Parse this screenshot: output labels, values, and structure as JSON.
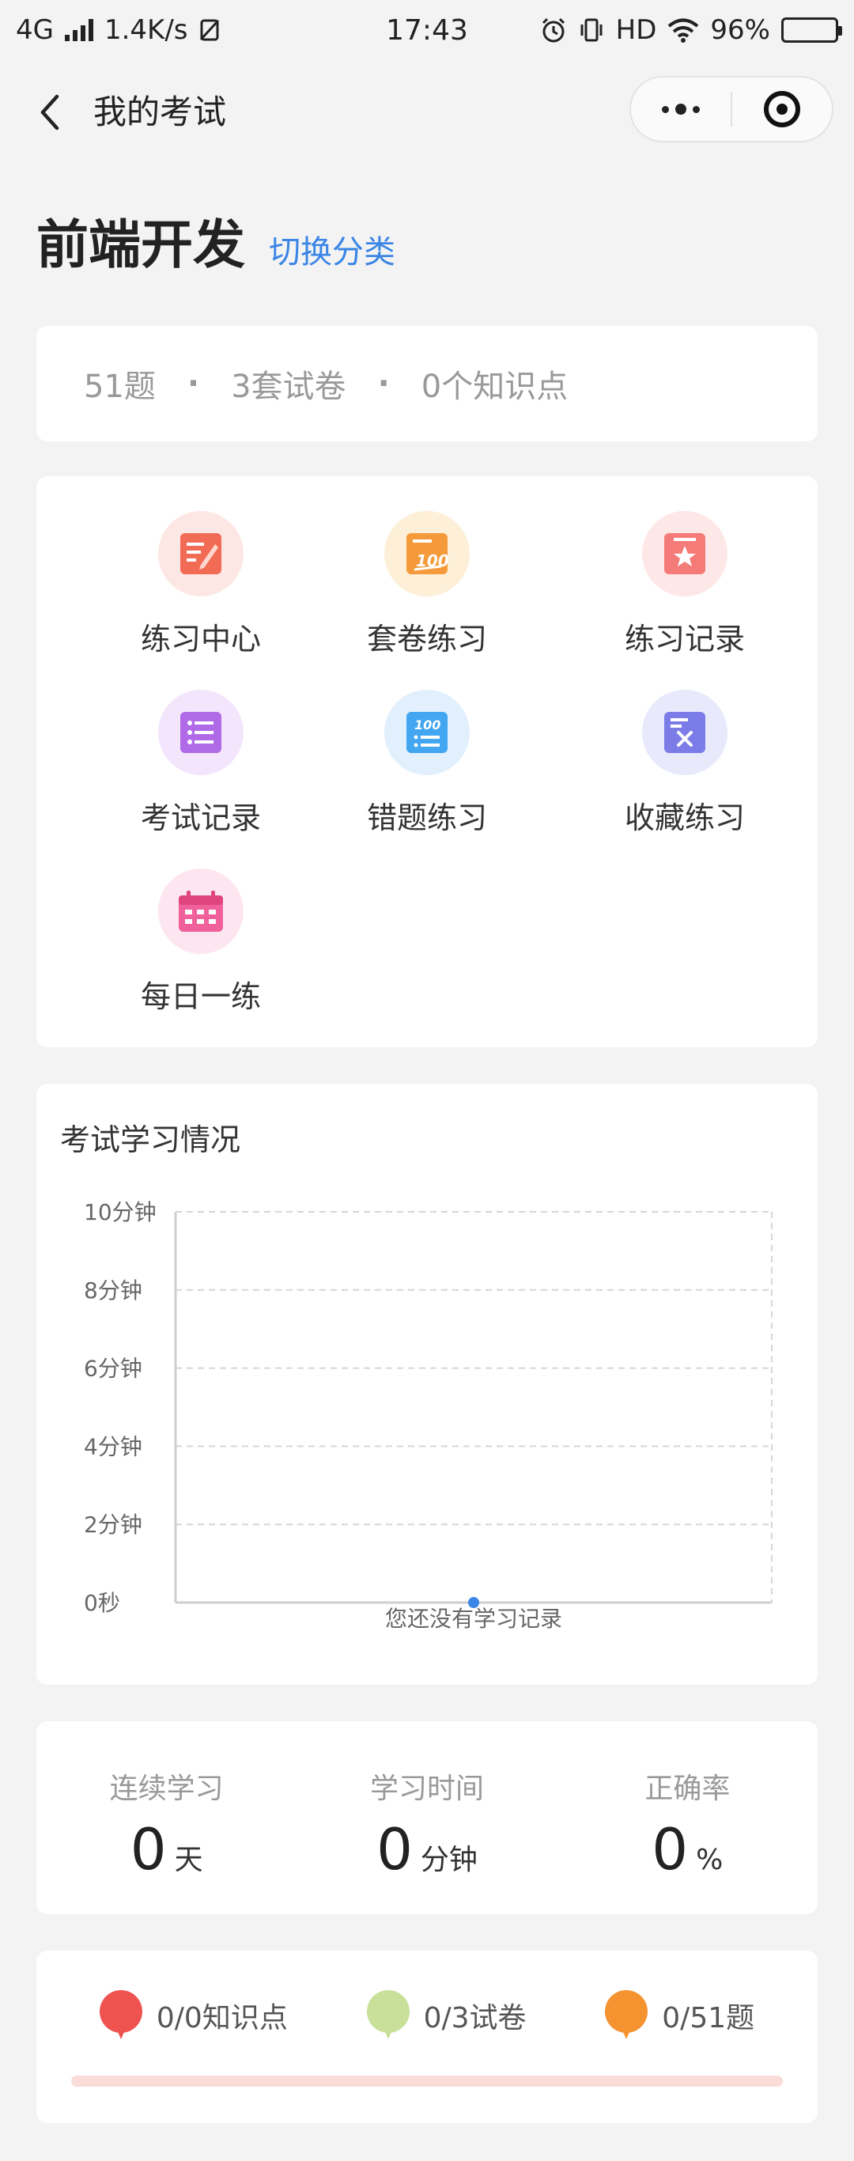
{
  "status_bar": {
    "network": "4G",
    "speed": "1.4K/s",
    "time": "17:43",
    "hd": "HD",
    "battery": "96%",
    "battery_level": 0.96
  },
  "nav": {
    "title": "我的考试",
    "icons": [
      "back-arrow-icon",
      "more-dots-icon",
      "target-icon"
    ]
  },
  "heading": {
    "title": "前端开发",
    "switch_label": "切换分类"
  },
  "summary": {
    "questions": "51题",
    "papers": "3套试卷",
    "points": "0个知识点",
    "separator": "·"
  },
  "menu": [
    {
      "label": "练习中心",
      "icon": "practice-center-icon",
      "bg": "#fde7e4",
      "color": "#f26b55"
    },
    {
      "label": "套卷练习",
      "icon": "paper-100-icon",
      "bg": "#fdefd8",
      "color": "#f59a3a"
    },
    {
      "label": "练习记录",
      "icon": "star-record-icon",
      "bg": "#fde8e7",
      "color": "#f47b77"
    },
    {
      "label": "考试记录",
      "icon": "list-record-icon",
      "bg": "#f3e5fc",
      "color": "#b06ae8"
    },
    {
      "label": "错题练习",
      "icon": "wrong-question-icon",
      "bg": "#e2f0fd",
      "color": "#43a6f0"
    },
    {
      "label": "收藏练习",
      "icon": "favorite-practice-icon",
      "bg": "#e8e9fb",
      "color": "#7c7ce8"
    },
    {
      "label": "每日一练",
      "icon": "calendar-icon",
      "bg": "#fde6ef",
      "color": "#f0619b"
    }
  ],
  "chart_card": {
    "title": "考试学习情况"
  },
  "chart_data": {
    "type": "line",
    "title": "考试学习情况",
    "xlabel": "",
    "ylabel": "",
    "yticks": [
      "0秒",
      "2分钟",
      "4分钟",
      "6分钟",
      "8分钟",
      "10分钟"
    ],
    "ylim": [
      0,
      10
    ],
    "grid": true,
    "x": [],
    "series": [
      {
        "values": []
      }
    ],
    "empty_message": "您还没有学习记录",
    "accent": "#3a85e6"
  },
  "stats": [
    {
      "label": "连续学习",
      "value": "0",
      "unit": "天"
    },
    {
      "label": "学习时间",
      "value": "0",
      "unit": "分钟"
    },
    {
      "label": "正确率",
      "value": "0",
      "unit": "%"
    }
  ],
  "progress": {
    "items": [
      {
        "label": "0/0知识点",
        "color": "#ef5350"
      },
      {
        "label": "0/3试卷",
        "color": "#c8e09a"
      },
      {
        "label": "0/51题",
        "color": "#f59331"
      }
    ],
    "fraction": 0
  }
}
